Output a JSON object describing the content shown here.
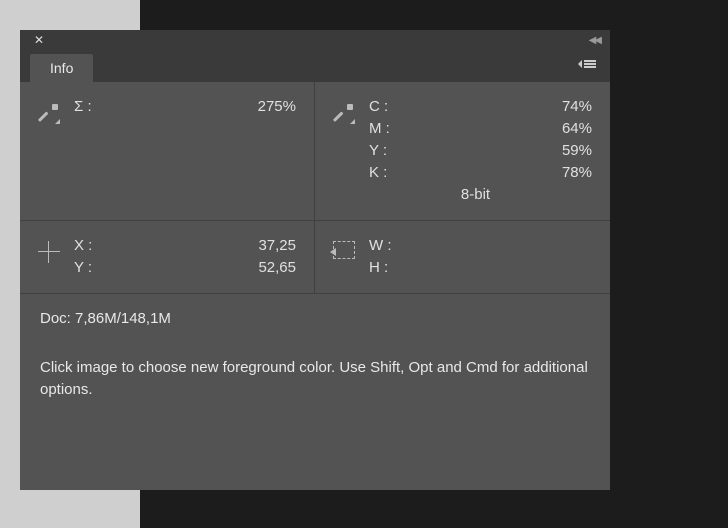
{
  "tab": {
    "label": "Info"
  },
  "section1": {
    "sigma_label": "Σ :",
    "sigma_value": "275%"
  },
  "section2": {
    "c_label": "C :",
    "c_value": "74%",
    "m_label": "M :",
    "m_value": "64%",
    "y_label": "Y :",
    "y_value": "59%",
    "k_label": "K :",
    "k_value": "78%",
    "depth": "8-bit"
  },
  "section3": {
    "x_label": "X :",
    "x_value": "37,25",
    "y_label": "Y :",
    "y_value": "52,65"
  },
  "section4": {
    "w_label": "W :",
    "w_value": "",
    "h_label": "H :",
    "h_value": ""
  },
  "doc": {
    "prefix": "Doc:",
    "value": "7,86M/148,1M"
  },
  "hint": "Click image to choose new foreground color.  Use Shift, Opt and Cmd for additional options."
}
